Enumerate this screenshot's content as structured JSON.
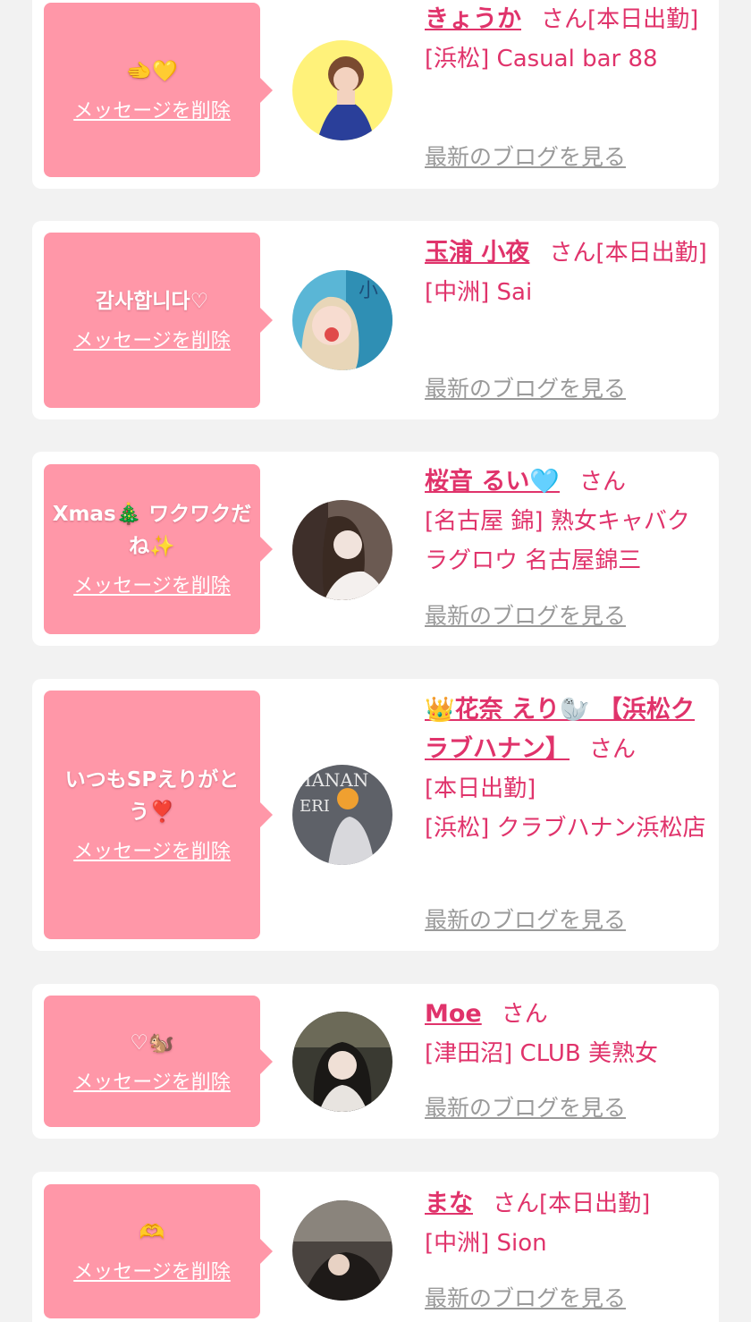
{
  "entries": [
    {
      "message": "🫲💛",
      "delete_label": "メッセージを削除",
      "name": "きょうか",
      "honorific": "さん",
      "status": "[本日出勤]",
      "shop": "[浜松] Casual bar 88",
      "blog_label": "最新のブログを見る",
      "avatar_color": "#fff27a"
    },
    {
      "message": "감사합니다♡",
      "delete_label": "メッセージを削除",
      "name": "玉浦 小夜",
      "honorific": "さん",
      "status": "[本日出勤]",
      "shop": "[中洲] Sai",
      "blog_label": "最新のブログを見る",
      "avatar_color": "#5ab6d6"
    },
    {
      "message": "Xmas🎄 ワクワクだね✨",
      "delete_label": "メッセージを削除",
      "name": "桜音 るい🩵",
      "honorific": "さん",
      "status": "",
      "shop": "[名古屋 錦] 熟女キャバクラグロウ 名古屋錦三",
      "blog_label": "最新のブログを見る",
      "avatar_color": "#6b5a52"
    },
    {
      "message": "いつもSPえりがとう❣️",
      "delete_label": "メッセージを削除",
      "name": "👑花奈 えり🦭 【浜松クラブハナン】",
      "honorific": "さん",
      "status": "[本日出勤]",
      "shop": "[浜松] クラブハナン浜松店",
      "blog_label": "最新のブログを見る",
      "avatar_color": "#5e6168"
    },
    {
      "message": "♡🐿️",
      "delete_label": "メッセージを削除",
      "name": "Moe",
      "honorific": "さん",
      "status": "",
      "shop": "[津田沼] CLUB 美熟女",
      "blog_label": "最新のブログを見る",
      "avatar_color": "#3a3a32"
    },
    {
      "message": "🫶",
      "delete_label": "メッセージを削除",
      "name": "まな",
      "honorific": "さん",
      "status": "[本日出勤]",
      "shop": "[中洲] Sion",
      "blog_label": "最新のブログを見る",
      "avatar_color": "#4a4440"
    }
  ],
  "colors": {
    "accent": "#e0336b",
    "bubble": "#ff97a8",
    "background": "#f2f2f2"
  }
}
